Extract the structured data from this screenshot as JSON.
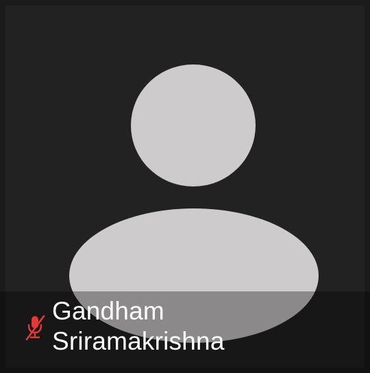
{
  "participant": {
    "first_name": "Gandham",
    "last_name": "Sriramakrishna",
    "muted": true,
    "mic_icon": "mic-off-icon"
  },
  "colors": {
    "tile_background": "#222222",
    "avatar": "#cdcbcb",
    "mic_muted": "#e53935",
    "name_text": "#ffffff"
  }
}
